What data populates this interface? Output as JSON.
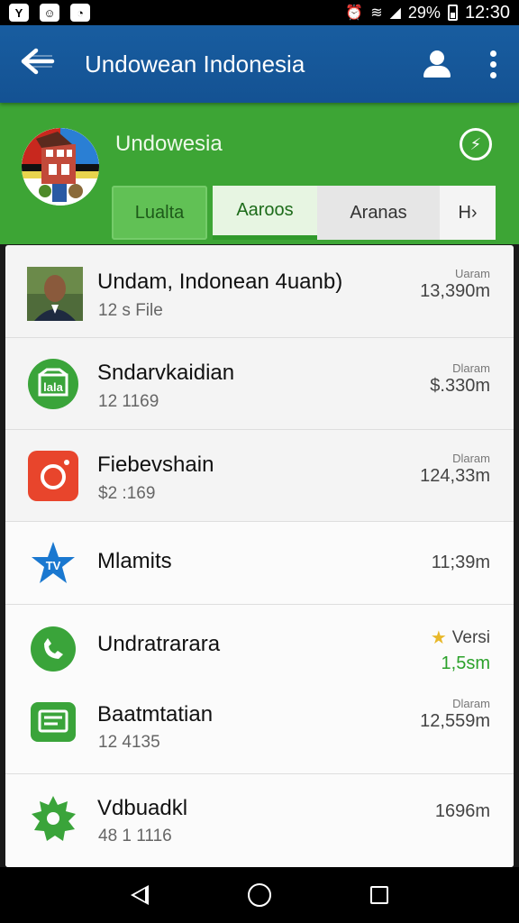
{
  "status_bar": {
    "battery": "29%",
    "time": "12:30",
    "left_icons": [
      "sim-icon",
      "chat-icon",
      "clock-icon"
    ]
  },
  "app_bar": {
    "title": "Undowean Indonesia"
  },
  "header": {
    "title": "Undowesia",
    "tabs": [
      "Lualta",
      "Aaroos",
      "Aranas",
      "H"
    ]
  },
  "list": {
    "items": [
      {
        "title": "Undam, Indonean 4uanb)",
        "subtitle": "12 s File",
        "meta_label": "Uaram",
        "meta_value": "13,390m",
        "icon": "person-photo-icon"
      },
      {
        "title": "Sndarvkaidian",
        "subtitle": "12 1169",
        "meta_label": "Dlaram",
        "meta_value": "$.330m",
        "icon": "store-icon"
      },
      {
        "title": "Fiebevshain",
        "subtitle": "$2 :169",
        "meta_label": "Dlaram",
        "meta_value": "124,33m",
        "icon": "camera-icon"
      },
      {
        "title": "Mlamits",
        "subtitle": "",
        "meta_label": "",
        "meta_value": "11;39m",
        "icon": "star-icon"
      },
      {
        "title": "Undratrarara",
        "subtitle": "",
        "meta_label": "Versi",
        "meta_value": "1,5sm",
        "icon": "phone-icon"
      },
      {
        "title": "Baatmtatian",
        "subtitle": "12 4135",
        "meta_label": "Dlaram",
        "meta_value": "12,559m",
        "icon": "chat-icon"
      },
      {
        "title": "Vdbuadkl",
        "subtitle": "48 1 1116",
        "meta_label": "",
        "meta_value": "1696m",
        "icon": "gear-icon"
      }
    ]
  },
  "colors": {
    "app_bar": "#185da0",
    "header_green": "#3da535",
    "accent_green": "#2ba12a",
    "camera_red": "#e8452c"
  }
}
